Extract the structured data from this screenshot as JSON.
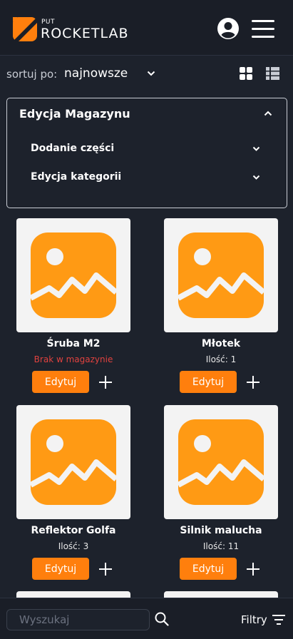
{
  "header": {
    "logo_put": "PUT",
    "logo_name": "ROCKETLAB",
    "brand_color": "#ff7f0d",
    "profile_icon": "user-circle-icon",
    "menu_icon": "hamburger-icon"
  },
  "sort": {
    "label": "sortuj po:",
    "value": "najnowsze",
    "options_icon": "chevron-down-icon",
    "view_grid_icon": "grid-view-icon",
    "view_list_icon": "list-view-icon"
  },
  "panel": {
    "title": "Edycja Magazynu",
    "items": [
      {
        "label": "Dodanie części"
      },
      {
        "label": "Edycja kategorii"
      }
    ]
  },
  "products": [
    {
      "name": "Śruba M2",
      "qty": "Brak w magazynie",
      "out_of_stock": true,
      "edit_label": "Edytuj"
    },
    {
      "name": "Młotek",
      "qty": "Ilość: 1",
      "out_of_stock": false,
      "edit_label": "Edytuj"
    },
    {
      "name": "Reflektor Golfa",
      "qty": "Ilość: 3",
      "out_of_stock": false,
      "edit_label": "Edytuj"
    },
    {
      "name": "Silnik malucha",
      "qty": "Ilość: 11",
      "out_of_stock": false,
      "edit_label": "Edytuj"
    }
  ],
  "bottom": {
    "search_placeholder": "Wyszukaj",
    "filters_label": "Filtry"
  },
  "colors": {
    "background": "#1d222c",
    "accent": "#ff7f0d",
    "out_of_stock": "#e0423f"
  }
}
